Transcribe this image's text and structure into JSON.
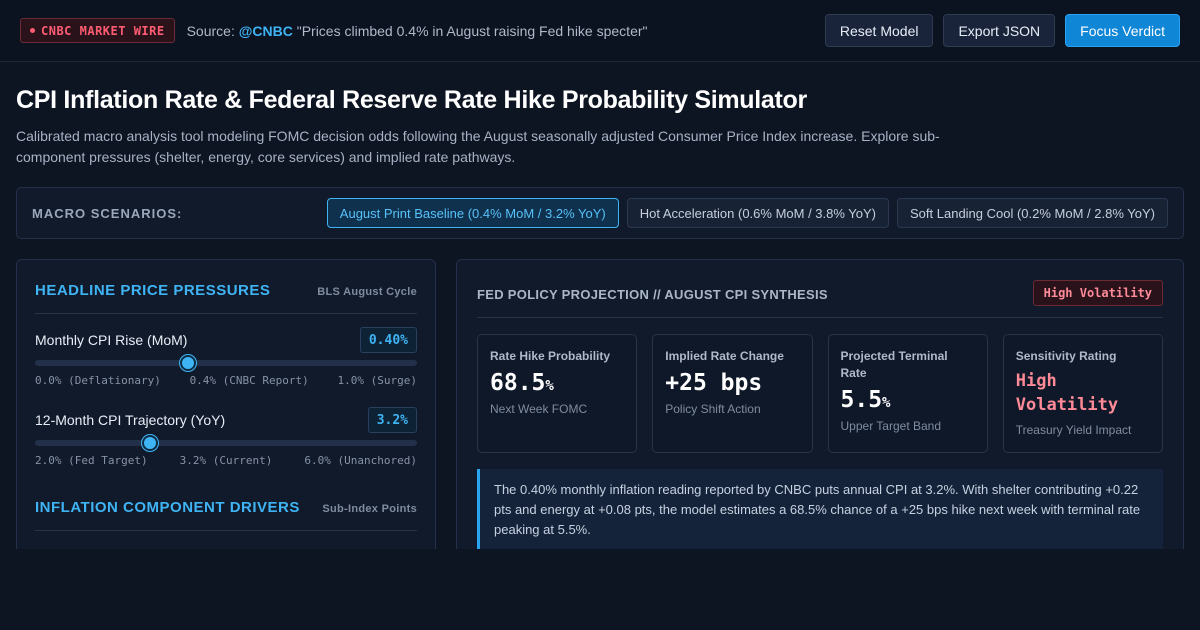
{
  "topbar": {
    "badge": "CNBC MARKET WIRE",
    "source_prefix": "Source:",
    "source_handle": "@CNBC",
    "source_quote": "\"Prices climbed 0.4% in August raising Fed hike specter\"",
    "buttons": {
      "reset": "Reset Model",
      "export": "Export JSON",
      "focus": "Focus Verdict"
    }
  },
  "header": {
    "title": "CPI Inflation Rate & Federal Reserve Rate Hike Probability Simulator",
    "subtitle": "Calibrated macro analysis tool modeling FOMC decision odds following the August seasonally adjusted Consumer Price Index increase. Explore sub-component pressures (shelter, energy, core services) and implied rate pathways."
  },
  "scenarios": {
    "label": "MACRO SCENARIOS:",
    "items": [
      {
        "label": "August Print Baseline (0.4% MoM / 3.2% YoY)",
        "active": true
      },
      {
        "label": "Hot Acceleration (0.6% MoM / 3.8% YoY)",
        "active": false
      },
      {
        "label": "Soft Landing Cool (0.2% MoM / 2.8% YoY)",
        "active": false
      }
    ]
  },
  "pressures": {
    "title": "HEADLINE PRICE PRESSURES",
    "note": "BLS August Cycle",
    "mom": {
      "label": "Monthly CPI Rise (MoM)",
      "value": "0.40%",
      "level_pct": 40,
      "ticks": [
        "0.0% (Deflationary)",
        "0.4% (CNBC Report)",
        "1.0% (Surge)"
      ]
    },
    "yoy": {
      "label": "12-Month CPI Trajectory (YoY)",
      "value": "3.2%",
      "level_pct": 30,
      "ticks": [
        "2.0% (Fed Target)",
        "3.2% (Current)",
        "6.0% (Unanchored)"
      ]
    }
  },
  "drivers": {
    "title": "INFLATION COMPONENT DRIVERS",
    "note": "Sub-Index Points"
  },
  "projection": {
    "title": "FED POLICY PROJECTION // AUGUST CPI SYNTHESIS",
    "badge": "High Volatility",
    "cards": [
      {
        "label": "Rate Hike Probability",
        "value": "68.5",
        "unit": "%",
        "sub": "Next Week FOMC"
      },
      {
        "label": "Implied Rate Change",
        "value": "+25 bps",
        "unit": "",
        "sub": "Policy Shift Action"
      },
      {
        "label": "Projected Terminal Rate",
        "value": "5.5",
        "unit": "%",
        "sub": "Upper Target Band"
      },
      {
        "label": "Sensitivity Rating",
        "value": "High Volatility",
        "unit": "",
        "sub": "Treasury Yield Impact"
      }
    ],
    "summary": "The 0.40% monthly inflation reading reported by CNBC puts annual CPI at 3.2%. With shelter contributing +0.22 pts and energy at +0.08 pts, the model estimates a 68.5% chance of a +25 bps hike next week with terminal rate peaking at 5.5%."
  },
  "colors": {
    "accent": "#3fb4f4",
    "alert": "#ff8a98",
    "primary_button": "#0f86d6"
  }
}
